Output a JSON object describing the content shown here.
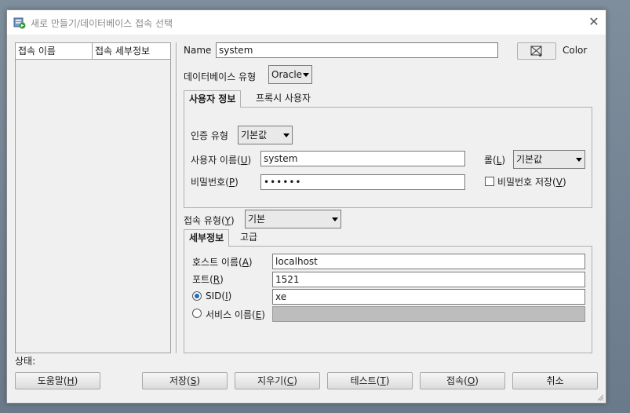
{
  "window": {
    "title": "새로 만들기/데이터베이스 접속 선택",
    "close_glyph": "✕"
  },
  "connection_list": {
    "columns": [
      "접속 이름",
      "접속 세부정보"
    ]
  },
  "form": {
    "name_label": "Name",
    "name_value": "system",
    "color_label": "Color",
    "db_type_label": "데이터베이스 유형",
    "db_type_value": "Oracle"
  },
  "auth_tabs": [
    "사용자 정보",
    "프록시 사용자"
  ],
  "user_info": {
    "auth_type_label": "인증 유형",
    "auth_type_value": "기본값",
    "username_label": "사용자 이름(",
    "username_key": "U",
    "username_value": "system",
    "role_label": "롤(",
    "role_key": "L",
    "role_value": "기본값",
    "password_label": "비밀번호(",
    "password_key": "P",
    "password_value": "••••••",
    "save_password_label": "비밀번호 저장(",
    "save_password_key": "V",
    "save_password_checked": false
  },
  "connection_type": {
    "label": "접속 유형(",
    "key": "Y",
    "value": "기본"
  },
  "detail_tabs": [
    "세부정보",
    "고급"
  ],
  "details": {
    "host_label": "호스트 이름(",
    "host_key": "A",
    "host_value": "localhost",
    "port_label": "포트(",
    "port_key": "R",
    "port_value": "1521",
    "sid_label": "SID(",
    "sid_key": "I",
    "sid_value": "xe",
    "sid_selected": true,
    "service_label": "서비스 이름(",
    "service_key": "E",
    "service_value": "",
    "service_selected": false
  },
  "status_label": "상태:",
  "buttons": [
    {
      "label": "도움말(",
      "key": "H"
    },
    {
      "label": "저장(",
      "key": "S"
    },
    {
      "label": "지우기(",
      "key": "C"
    },
    {
      "label": "테스트(",
      "key": "T"
    },
    {
      "label": "접속(",
      "key": "O"
    },
    {
      "label": "취소",
      "key": ""
    }
  ],
  "icons": [
    "app-db-icon",
    "close-icon",
    "color-picker-icon",
    "dropdown-arrow-icon",
    "resize-grip-icon"
  ]
}
